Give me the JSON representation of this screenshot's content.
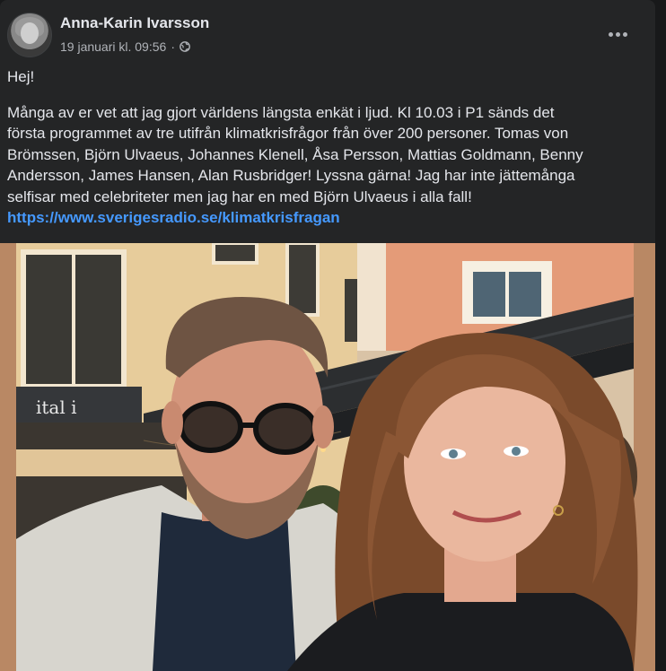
{
  "post": {
    "author": "Anna-Karin Ivarsson",
    "timestamp": "19 januari kl. 09:56",
    "separator": "·",
    "audience_icon": "globe-icon",
    "more_icon": "more-options-icon",
    "text": {
      "greeting": "Hej!",
      "line1": "Många av er vet att jag gjort världens längsta enkät i ljud. Kl 10.03 i P1 sänds det",
      "line2": "första programmet av tre utifrån klimatkrisfrågor från över 200 personer. Tomas von",
      "line3": "Brömssen, Björn Ulvaeus, Johannes Klenell, Åsa Persson, Mattias Goldmann, Benny",
      "line4": "Andersson, James Hansen, Alan Rusbridger! Lyssna gärna! Jag har inte jättemånga",
      "line5": "selfisar med celebriteter men jag har en med Björn Ulvaeus i alla fall!",
      "link": "https://www.sverigesradio.se/klimatkrisfragan"
    },
    "colors": {
      "card_bg": "#242526",
      "text": "#e4e6eb",
      "secondary_text": "#b0b3b8",
      "link": "#4599ff"
    }
  }
}
